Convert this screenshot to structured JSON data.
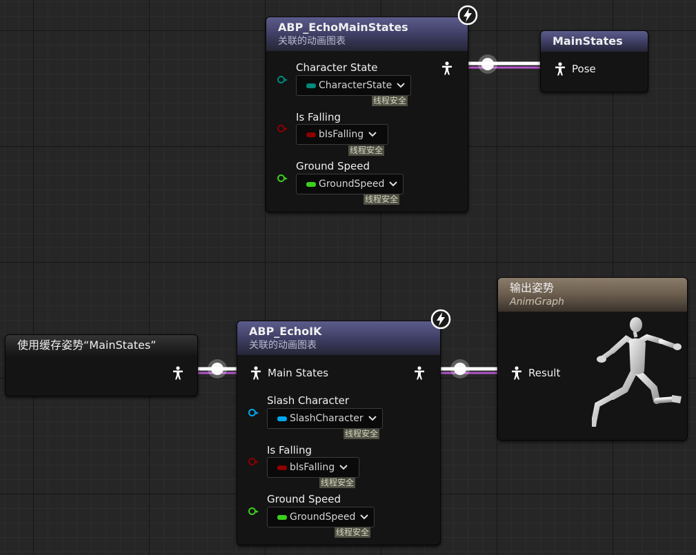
{
  "colors": {
    "exec_wire": "#ffffff",
    "pose_wire_accent": "#b254c9",
    "enum_pin": "#00897b",
    "bool_pin": "#8b0000",
    "float_pin": "#3bcf1f",
    "object_pin": "#00a8ef",
    "header_blue": "#4a4a7a",
    "header_output": "#7a6a5a"
  },
  "icons": {
    "pose_pin": "person-icon",
    "fast_path": "lightning-bolt-icon",
    "dropdown": "chevron-down-icon",
    "preview": "mannequin-icon"
  },
  "thread_safe_label": "线程安全",
  "nodes": {
    "echo_main_states": {
      "title": "ABP_EchoMainStates",
      "subtitle": "关联的动画图表",
      "rows": [
        {
          "label": "Character State",
          "value": "CharacterState"
        },
        {
          "label": "Is Falling",
          "value": "bIsFalling"
        },
        {
          "label": "Ground Speed",
          "value": "GroundSpeed"
        }
      ]
    },
    "main_states": {
      "title": "MainStates",
      "pin_label": "Pose"
    },
    "cached_pose": {
      "title": "使用缓存姿势“MainStates”"
    },
    "echo_ik": {
      "title": "ABP_EchoIK",
      "subtitle": "关联的动画图表",
      "input_label": "Main States",
      "rows": [
        {
          "label": "Slash Character",
          "value": "SlashCharacter"
        },
        {
          "label": "Is Falling",
          "value": "bIsFalling"
        },
        {
          "label": "Ground Speed",
          "value": "GroundSpeed"
        }
      ]
    },
    "output_pose": {
      "title": "输出姿势",
      "subtitle": "AnimGraph",
      "pin_label": "Result"
    }
  }
}
